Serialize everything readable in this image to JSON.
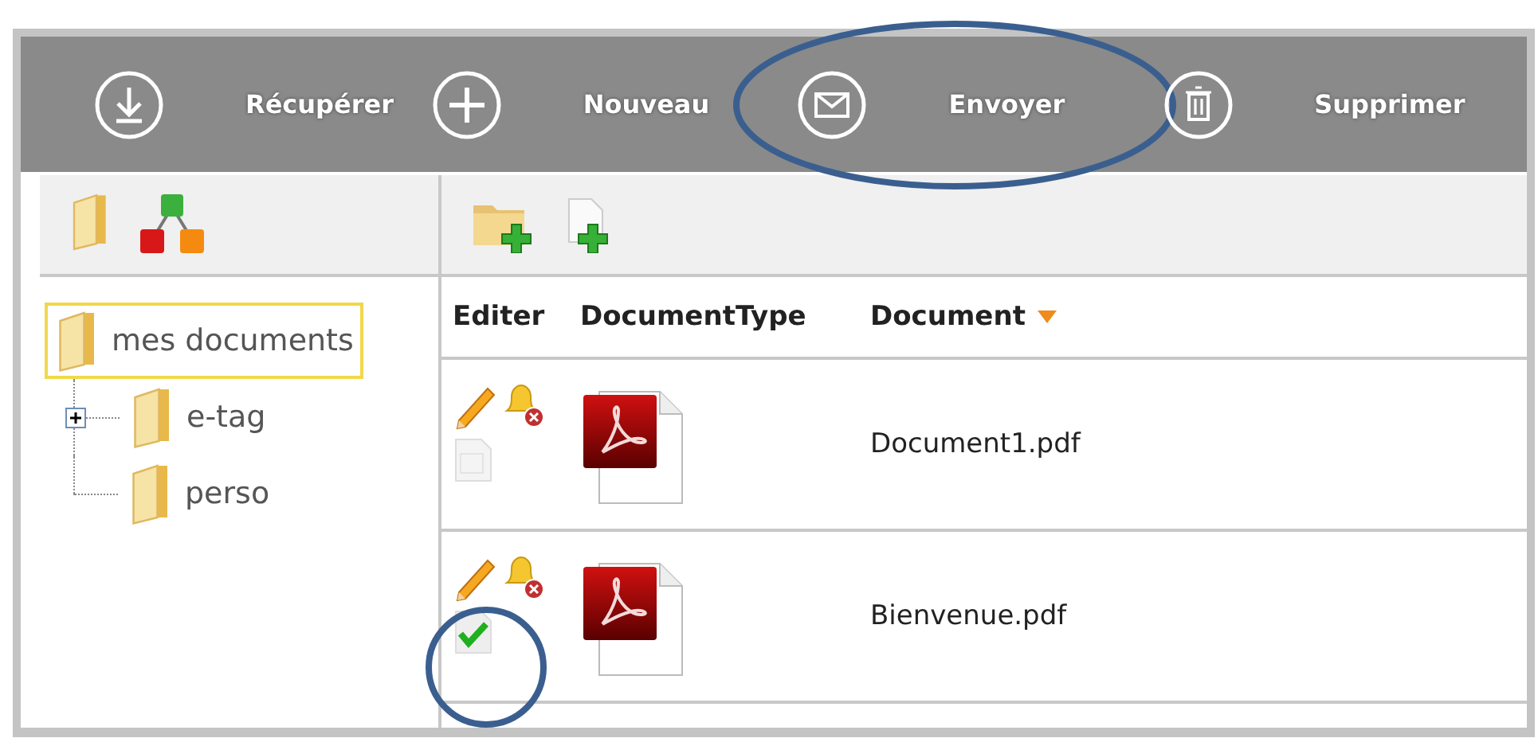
{
  "toolbar": [
    {
      "kind": "download",
      "label": "Récupérer",
      "circled": false
    },
    {
      "kind": "add",
      "label": "Nouveau",
      "circled": false
    },
    {
      "kind": "mail",
      "label": "Envoyer",
      "circled": true
    },
    {
      "kind": "trash",
      "label": "Supprimer",
      "circled": false
    }
  ],
  "tree": [
    {
      "label": "mes documents",
      "selected": true,
      "children": [
        {
          "label": "e-tag",
          "selected": false,
          "expanded": false
        },
        {
          "label": "perso",
          "selected": false
        }
      ]
    }
  ],
  "table": {
    "columns": [
      {
        "label": "Editer",
        "sorted": false
      },
      {
        "label": "DocumentType",
        "sorted": false
      },
      {
        "label": "Document",
        "sorted": true
      }
    ],
    "rows": [
      {
        "document": "Document1.pdf",
        "validated": false,
        "circled": false
      },
      {
        "document": "Bienvenue.pdf",
        "validated": true,
        "circled": true
      }
    ]
  }
}
